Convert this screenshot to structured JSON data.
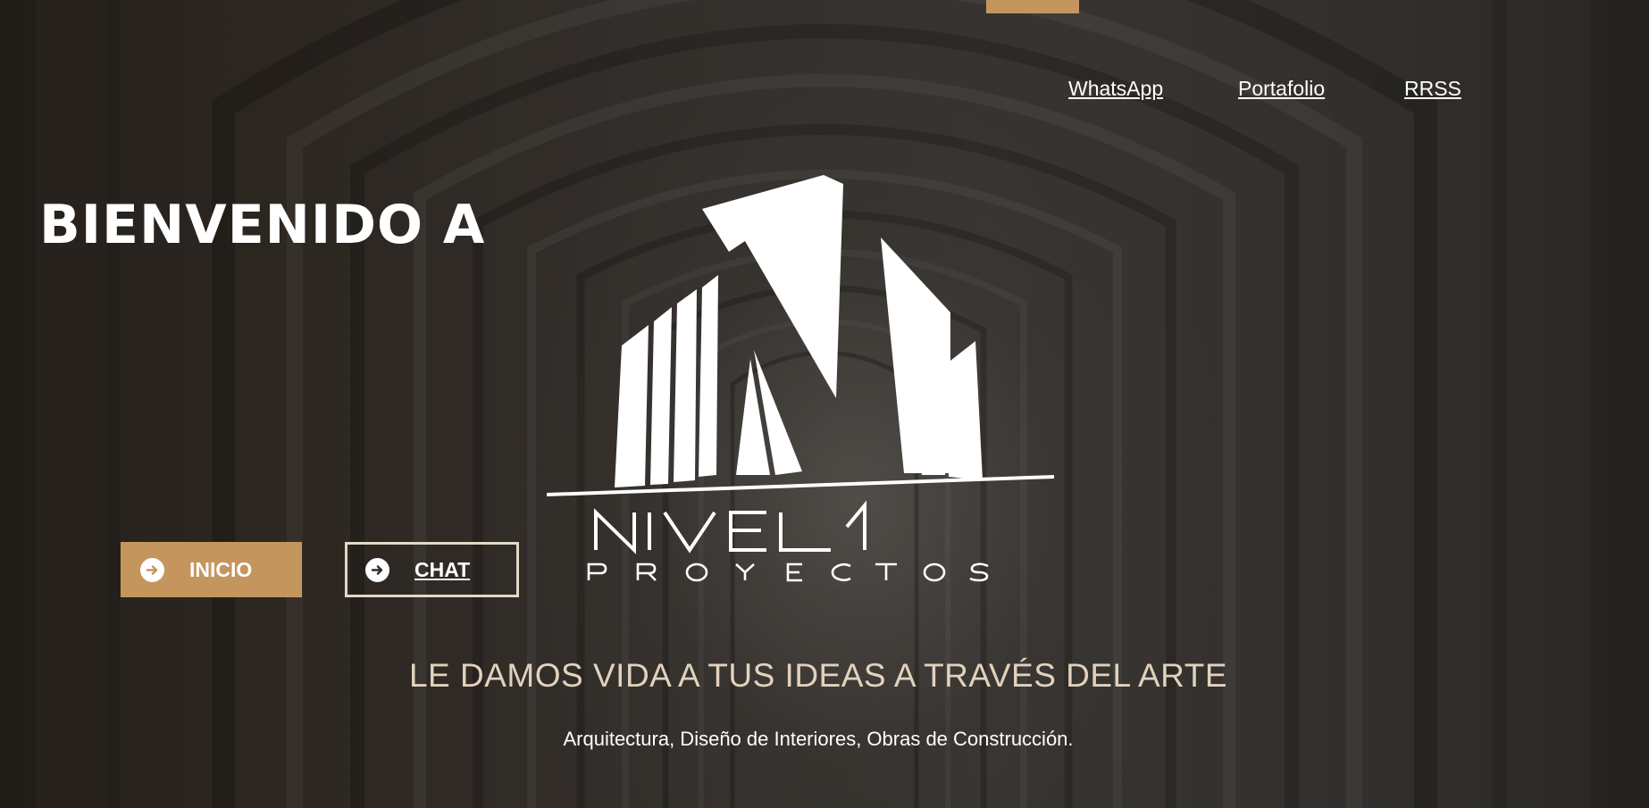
{
  "nav": {
    "items": [
      {
        "label": "WhatsApp"
      },
      {
        "label": "Portafolio"
      },
      {
        "label": "RRSS"
      }
    ]
  },
  "hero": {
    "title": "BIENVENIDO A",
    "buttons": {
      "inicio_label": "INICIO",
      "chat_label": "CHAT"
    },
    "logo": {
      "wordmark": "NIVEL1",
      "sub_wordmark": "PROYECTOS",
      "icon": "buildings-logo-icon"
    },
    "tagline": "LE DAMOS VIDA A TUS IDEAS A TRAVÉS DEL ARTE",
    "subtitle": "Arquitectura, Diseño de Interiores, Obras de Construcción."
  },
  "colors": {
    "accent": "#c4965e",
    "tagline": "#e2d2bd",
    "background": "#3a3734"
  },
  "icons": {
    "button_arrow": "arrow-right-circle-icon"
  }
}
